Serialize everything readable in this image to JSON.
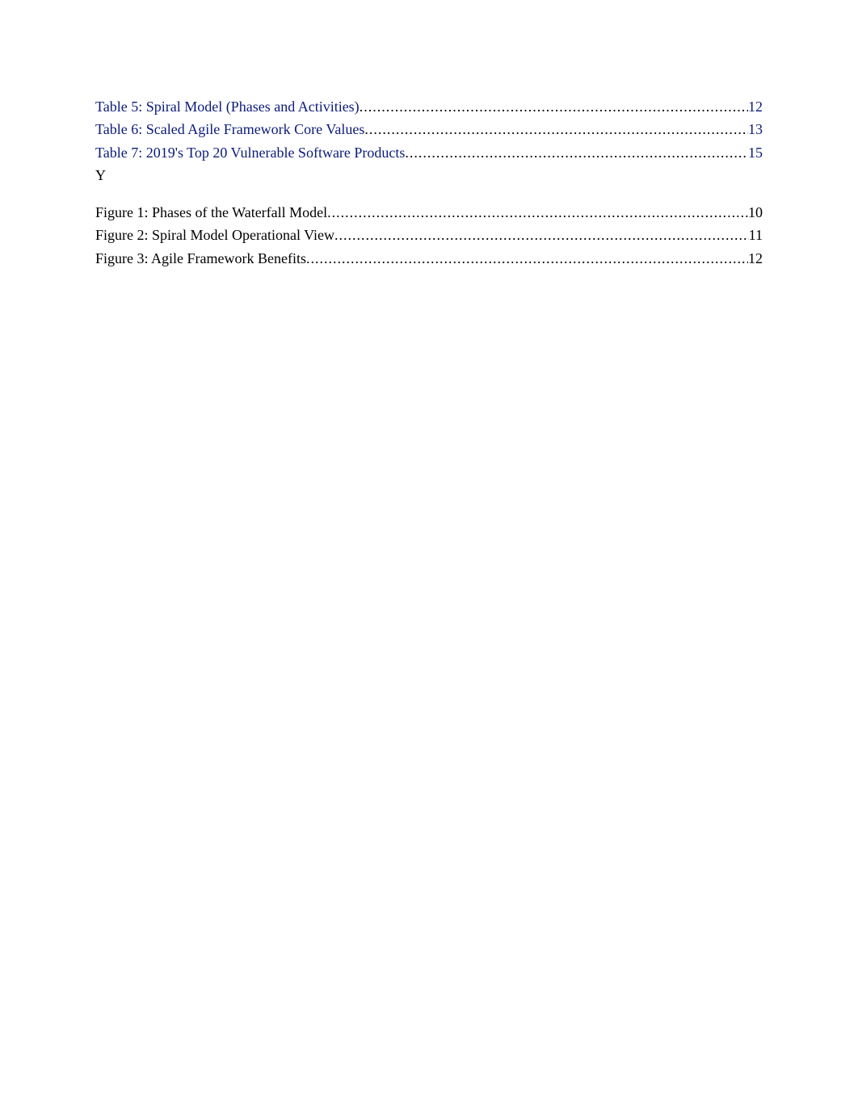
{
  "tables": [
    {
      "title": "Table 5: Spiral Model (Phases and Activities)",
      "page": "12"
    },
    {
      "title": "Table 6: Scaled Agile Framework Core Values",
      "page": "13"
    },
    {
      "title": "Table 7: 2019's Top 20 Vulnerable Software Products",
      "page": "15"
    }
  ],
  "stray_text": "Y",
  "figures": [
    {
      "title": "Figure 1: Phases of the Waterfall Model",
      "page": "10"
    },
    {
      "title": "Figure 2: Spiral Model Operational View",
      "page": "11"
    },
    {
      "title": "Figure 3: Agile Framework Benefits",
      "page": "12"
    }
  ],
  "dots": "................................................................................................................................................................................................................................................................"
}
